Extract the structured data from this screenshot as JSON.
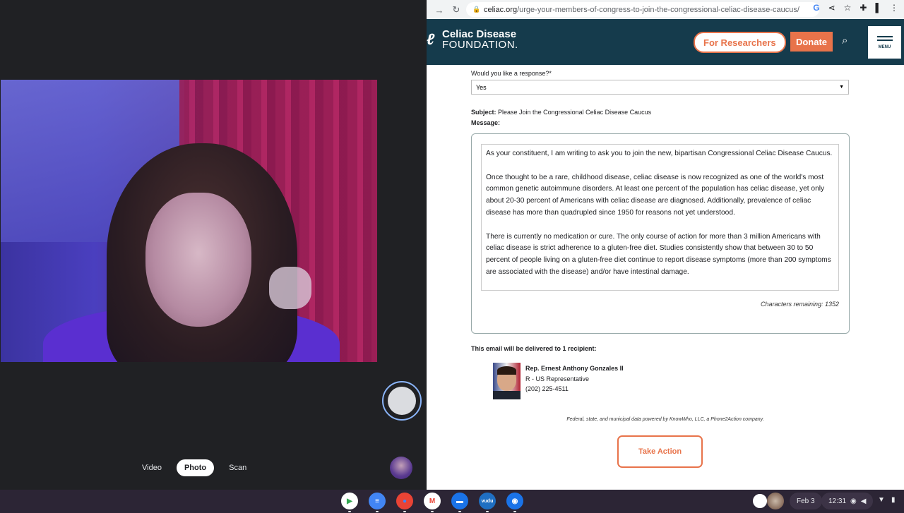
{
  "camera": {
    "modes": [
      {
        "label": "Video",
        "active": false
      },
      {
        "label": "Photo",
        "active": true
      },
      {
        "label": "Scan",
        "active": false
      }
    ]
  },
  "browser": {
    "url_domain": "celiac.org",
    "url_path": "/urge-your-members-of-congress-to-join-the-congressional-celiac-disease-caucus/"
  },
  "site": {
    "logo_line1": "Celiac Disease",
    "logo_line2": "FOUNDATION.",
    "researchers_label": "For Researchers",
    "donate_label": "Donate",
    "menu_label": "MENU",
    "accent_color": "#e8734a",
    "header_color": "#153b4c"
  },
  "form": {
    "response_label": "Would you like a response?*",
    "response_value": "Yes",
    "subject_label": "Subject:",
    "subject_value": "Please Join the Congressional Celiac Disease Caucus",
    "message_label": "Message:",
    "message_paragraphs": [
      "As your constituent, I am writing to ask you to join the new, bipartisan Congressional Celiac Disease Caucus.",
      "Once thought to be a rare, childhood disease, celiac disease is now recognized as one of the world's most common genetic autoimmune disorders. At least one percent of the population has celiac disease, yet only about 20-30 percent of Americans with celiac disease are diagnosed. Additionally, prevalence of celiac disease has more than quadrupled since 1950 for reasons not yet understood.",
      "There is currently no medication or cure. The only course of action for more than 3 million Americans with celiac disease is strict adherence to a gluten-free diet. Studies consistently show that between 30 to 50 percent of people living on a gluten-free diet continue to report disease symptoms (more than 200 symptoms are associated with the disease) and/or have intestinal damage."
    ],
    "chars_remaining": "Characters remaining: 1352",
    "deliver_label": "This email will be delivered to 1 recipient:",
    "recipient": {
      "name": "Rep. Ernest Anthony Gonzales II",
      "role": "R - US Representative",
      "phone": "(202) 225-4511"
    },
    "powered_by": "Federal, state, and municipal data powered by KnowWho, LLC, a Phone2Action company.",
    "submit_label": "Take Action"
  },
  "shelf": {
    "apps": [
      {
        "name": "play-store-icon",
        "glyph": "▶",
        "color": "#ffffff",
        "fg": "#34a853"
      },
      {
        "name": "docs-icon",
        "glyph": "≡",
        "color": "#4285f4",
        "fg": "#ffffff"
      },
      {
        "name": "chrome-icon",
        "glyph": "●",
        "color": "#ea4335",
        "fg": "#4285f4"
      },
      {
        "name": "gmail-icon",
        "glyph": "M",
        "color": "#ffffff",
        "fg": "#ea4335"
      },
      {
        "name": "files-icon",
        "glyph": "▬",
        "color": "#1a73e8",
        "fg": "#ffffff"
      },
      {
        "name": "vudu-icon",
        "glyph": "vudu",
        "color": "#1f6fc2",
        "fg": "#ffffff"
      },
      {
        "name": "camera-icon",
        "glyph": "◉",
        "color": "#1a73e8",
        "fg": "#ffffff"
      }
    ],
    "date": "Feb 3",
    "time": "12:31"
  }
}
